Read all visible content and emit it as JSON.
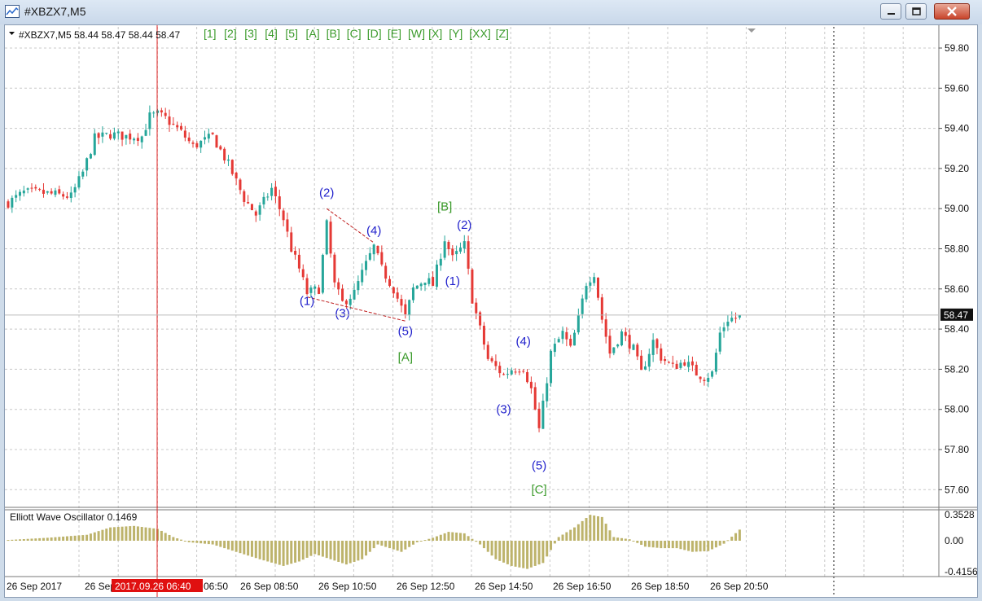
{
  "window": {
    "title": "#XBZX7,M5",
    "buttons": [
      "minimize",
      "restore",
      "close"
    ]
  },
  "header": {
    "symbol_line": "#XBZX7,M5  58.44 58.47 58.44 58.47",
    "wave_buttons": [
      "[1]",
      "[2]",
      "[3]",
      "[4]",
      "[5]",
      "[A]",
      "[B]",
      "[C]",
      "[D]",
      "[E]",
      "[W]",
      "[X]",
      "[Y]",
      "[XX]",
      "[Z]"
    ]
  },
  "colors": {
    "bull": "#26a69a",
    "bear": "#e53935",
    "wave_blue": "#2222cc",
    "wave_green": "#3a9a2a",
    "histogram": "#bdb36b",
    "grid": "#c8c8c8",
    "crosshair": "#e02020"
  },
  "price_panel": {
    "current_price_label": "58.47",
    "current_price": 58.47,
    "crosshair_date_label": "2017.09.26 06:40"
  },
  "oscillator": {
    "label": "Elliott Wave Oscillator 0.1469",
    "y_labels": [
      "0.3528",
      "0.00",
      "-0.4156"
    ]
  },
  "wave_labels": [
    {
      "text": "(2)",
      "style": "blue",
      "bar": 81,
      "price": 59.06
    },
    {
      "text": "(4)",
      "style": "blue",
      "bar": 93,
      "price": 58.87
    },
    {
      "text": "(1)",
      "style": "blue",
      "bar": 76,
      "price": 58.52
    },
    {
      "text": "(3)",
      "style": "blue",
      "bar": 85,
      "price": 58.46
    },
    {
      "text": "(5)",
      "style": "blue",
      "bar": 101,
      "price": 58.37
    },
    {
      "text": "[A]",
      "style": "green",
      "bar": 101,
      "price": 58.24
    },
    {
      "text": "[B]",
      "style": "green",
      "bar": 111,
      "price": 58.99
    },
    {
      "text": "(2)",
      "style": "blue",
      "bar": 116,
      "price": 58.9
    },
    {
      "text": "(1)",
      "style": "blue",
      "bar": 113,
      "price": 58.62
    },
    {
      "text": "(4)",
      "style": "blue",
      "bar": 131,
      "price": 58.32
    },
    {
      "text": "(3)",
      "style": "blue",
      "bar": 126,
      "price": 57.98
    },
    {
      "text": "(5)",
      "style": "blue",
      "bar": 135,
      "price": 57.7
    },
    {
      "text": "[C]",
      "style": "green",
      "bar": 135,
      "price": 57.58
    }
  ],
  "chart_data": {
    "type": "candlestick",
    "title": "#XBZX7,M5",
    "ylim": [
      57.52,
      59.92
    ],
    "y_ticks": [
      57.6,
      57.8,
      58.0,
      58.2,
      58.4,
      58.6,
      58.8,
      59.0,
      59.2,
      59.4,
      59.6,
      59.8
    ],
    "y_tick_labels": [
      "57.60",
      "57.80",
      "58.00",
      "58.20",
      "58.40",
      "58.60",
      "58.80",
      "59.00",
      "59.20",
      "59.40",
      "59.60",
      "59.80"
    ],
    "x_tick_labels": [
      "26 Sep 2017",
      "26 Sep",
      "06:50",
      "26 Sep 08:50",
      "26 Sep 10:50",
      "26 Sep 12:50",
      "26 Sep 14:50",
      "26 Sep 16:50",
      "26 Sep 18:50",
      "26 Sep 20:50"
    ],
    "close_path": [
      [
        0,
        59.03
      ],
      [
        4,
        59.08
      ],
      [
        8,
        59.08
      ],
      [
        12,
        59.07
      ],
      [
        16,
        59.06
      ],
      [
        19,
        59.18
      ],
      [
        22,
        59.35
      ],
      [
        26,
        59.37
      ],
      [
        30,
        59.36
      ],
      [
        34,
        59.36
      ],
      [
        36,
        59.46
      ],
      [
        38,
        59.47
      ],
      [
        40,
        59.45
      ],
      [
        44,
        59.38
      ],
      [
        47,
        59.31
      ],
      [
        52,
        59.36
      ],
      [
        56,
        59.22
      ],
      [
        60,
        59.05
      ],
      [
        63,
        58.97
      ],
      [
        67,
        59.1
      ],
      [
        70,
        58.95
      ],
      [
        72,
        58.8
      ],
      [
        74,
        58.7
      ],
      [
        76,
        58.58
      ],
      [
        79,
        58.6
      ],
      [
        81,
        58.92
      ],
      [
        83,
        58.62
      ],
      [
        85,
        58.53
      ],
      [
        88,
        58.58
      ],
      [
        90,
        58.68
      ],
      [
        93,
        58.81
      ],
      [
        95,
        58.7
      ],
      [
        98,
        58.6
      ],
      [
        101,
        58.46
      ],
      [
        103,
        58.6
      ],
      [
        106,
        58.65
      ],
      [
        108,
        58.62
      ],
      [
        111,
        58.85
      ],
      [
        113,
        58.75
      ],
      [
        116,
        58.82
      ],
      [
        118,
        58.55
      ],
      [
        120,
        58.4
      ],
      [
        122,
        58.25
      ],
      [
        126,
        58.17
      ],
      [
        128,
        58.2
      ],
      [
        131,
        58.21
      ],
      [
        133,
        58.1
      ],
      [
        135,
        57.9
      ],
      [
        136,
        58.02
      ],
      [
        138,
        58.28
      ],
      [
        141,
        58.38
      ],
      [
        143,
        58.3
      ],
      [
        145,
        58.45
      ],
      [
        147,
        58.63
      ],
      [
        149,
        58.68
      ],
      [
        151,
        58.45
      ],
      [
        153,
        58.28
      ],
      [
        156,
        58.38
      ],
      [
        159,
        58.3
      ],
      [
        161,
        58.18
      ],
      [
        164,
        58.34
      ],
      [
        166,
        58.26
      ],
      [
        169,
        58.21
      ],
      [
        172,
        58.24
      ],
      [
        175,
        58.18
      ],
      [
        177,
        58.16
      ],
      [
        179,
        58.18
      ],
      [
        181,
        58.38
      ],
      [
        183,
        58.45
      ],
      [
        186,
        58.46
      ]
    ],
    "oscillator_path": [
      [
        0,
        0.01
      ],
      [
        10,
        0.04
      ],
      [
        20,
        0.08
      ],
      [
        26,
        0.18
      ],
      [
        32,
        0.2
      ],
      [
        38,
        0.16
      ],
      [
        42,
        0.05
      ],
      [
        46,
        -0.02
      ],
      [
        52,
        -0.05
      ],
      [
        58,
        -0.15
      ],
      [
        64,
        -0.25
      ],
      [
        70,
        -0.34
      ],
      [
        74,
        -0.28
      ],
      [
        78,
        -0.18
      ],
      [
        82,
        -0.25
      ],
      [
        86,
        -0.32
      ],
      [
        90,
        -0.25
      ],
      [
        94,
        -0.05
      ],
      [
        100,
        -0.15
      ],
      [
        104,
        -0.02
      ],
      [
        108,
        0.04
      ],
      [
        112,
        0.12
      ],
      [
        116,
        0.1
      ],
      [
        120,
        -0.05
      ],
      [
        124,
        -0.25
      ],
      [
        128,
        -0.34
      ],
      [
        132,
        -0.38
      ],
      [
        136,
        -0.3
      ],
      [
        140,
        0.05
      ],
      [
        144,
        0.18
      ],
      [
        148,
        0.35
      ],
      [
        151,
        0.32
      ],
      [
        154,
        0.05
      ],
      [
        158,
        0.02
      ],
      [
        162,
        -0.08
      ],
      [
        166,
        -0.1
      ],
      [
        170,
        -0.1
      ],
      [
        174,
        -0.15
      ],
      [
        178,
        -0.14
      ],
      [
        182,
        -0.04
      ],
      [
        186,
        0.15
      ]
    ]
  }
}
